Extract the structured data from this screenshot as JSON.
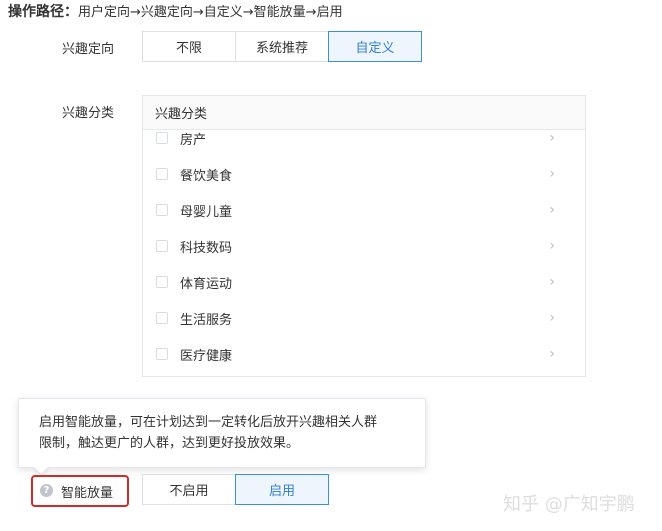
{
  "operation_path": {
    "label": "操作路径：",
    "steps": "用户定向→兴趣定向→自定义→智能放量→启用"
  },
  "interest_targeting": {
    "label": "兴趣定向",
    "options": [
      "不限",
      "系统推荐",
      "自定义"
    ],
    "selected": "自定义"
  },
  "interest_category": {
    "label": "兴趣分类",
    "panel_header": "兴趣分类",
    "items": [
      "房产",
      "餐饮美食",
      "母婴儿童",
      "科技数码",
      "体育运动",
      "生活服务",
      "医疗健康"
    ]
  },
  "tooltip": {
    "line1": "启用智能放量，可在计划达到一定转化后放开兴趣相关人群",
    "line2": "限制，触达更广的人群，达到更好投放效果。"
  },
  "smart_expansion": {
    "icon": "question-circle-icon",
    "label": "智能放量",
    "options": [
      "不启用",
      "启用"
    ],
    "selected": "启用"
  },
  "watermark": "知乎 @广知宇鹏",
  "colors": {
    "accent": "#2f7fd6",
    "active_bg": "#eef5fc",
    "highlight_border": "#d42a2a"
  }
}
